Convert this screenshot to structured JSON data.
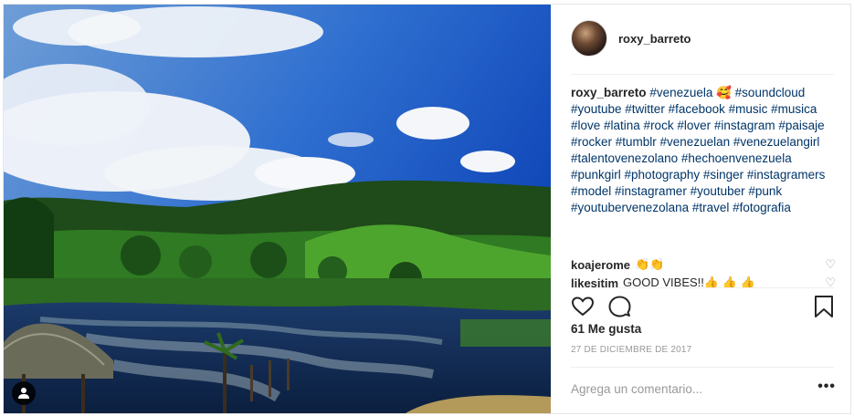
{
  "post": {
    "author": "roxy_barreto",
    "caption_text": "#venezuela 🥰 #soundcloud #youtube #twitter #facebook #music #musica #love #latina #rock #lover #instagram #paisaje #rocker #tumblr #venezuelan #venezuelangirl #talentovenezolano #hechoenvenezuela #punkgirl #photography #singer #instagramers #model #instagramer #youtuber #punk #youtubervenezolana #travel #fotografia",
    "likes": "61 Me gusta",
    "date": "27 DE DICIEMBRE DE 2017",
    "add_comment_placeholder": "Agrega un comentario...",
    "more_label": "•••"
  },
  "comments": [
    {
      "author": "koajerome",
      "text": "👏👏"
    },
    {
      "author": "likesitim",
      "text": "GOOD VIBES!!👍 👍 👍"
    }
  ],
  "icons": {
    "like": "heart-outline-icon",
    "comment": "speech-bubble-icon",
    "save": "bookmark-icon",
    "user_tag": "user-silhouette-icon"
  },
  "colors": {
    "hashtag": "#003569",
    "text": "#262626",
    "muted": "#999999",
    "border": "#efefef"
  }
}
